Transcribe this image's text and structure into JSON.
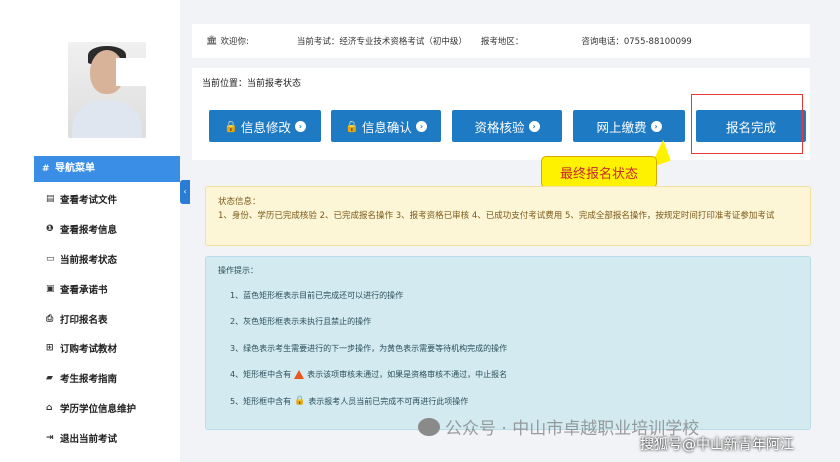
{
  "topbar": {
    "welcome": "欢迎你:",
    "current_exam": "当前考试：经济专业技术资格考试（初中级）",
    "region": "报考地区：",
    "phone": "咨询电话：0755-88100099"
  },
  "sidebar": {
    "nav_title": "导航菜单",
    "items": [
      {
        "icon": "file-icon",
        "label": "查看考试文件"
      },
      {
        "icon": "info-icon",
        "label": "查看报考信息"
      },
      {
        "icon": "monitor-icon",
        "label": "当前报考状态"
      },
      {
        "icon": "card-icon",
        "label": "查看承诺书"
      },
      {
        "icon": "print-icon",
        "label": "打印报名表"
      },
      {
        "icon": "cart-icon",
        "label": "订购考试教材"
      },
      {
        "icon": "book-icon",
        "label": "考生报考指南"
      },
      {
        "icon": "graduation-icon",
        "label": "学历学位信息维护"
      },
      {
        "icon": "logout-icon",
        "label": "退出当前考试"
      }
    ]
  },
  "breadcrumb": "当前位置：当前报考状态",
  "steps": [
    {
      "label": "信息修改",
      "locked": true
    },
    {
      "label": "信息确认",
      "locked": true
    },
    {
      "label": "资格核验",
      "locked": false
    },
    {
      "label": "网上缴费",
      "locked": false
    },
    {
      "label": "报名完成",
      "locked": false
    }
  ],
  "callout": "最终报名状态",
  "status": {
    "title": "状态信息：",
    "text": "1、身份、学历已完成核验 2、已完成报名操作 3、报考资格已审核 4、已成功支付考试费用 5、完成全部报名操作，按规定时间打印准考证参加考试"
  },
  "hints": {
    "title": "操作提示：",
    "items": [
      "1、蓝色矩形框表示目前已完成还可以进行的操作",
      "2、灰色矩形框表示未执行且禁止的操作",
      "3、绿色表示考生需要进行的下一步操作，为黄色表示需要等待机构完成的操作",
      "4、矩形框中含有",
      "5、矩形框中含有"
    ],
    "item4_suffix": "表示该项审核未通过，如果是资格审核不通过，中止报名",
    "item5_suffix": "表示报考人员当前已完成不可再进行此项操作"
  },
  "watermark": "公众号 · 中山市卓越职业培训学校",
  "watermark2": "搜狐号@中山新青年阿江",
  "colors": {
    "primary": "#1f7ac4",
    "nav_header": "#3a8ee6",
    "highlight": "#e53935",
    "callout_bg": "#fff200"
  }
}
